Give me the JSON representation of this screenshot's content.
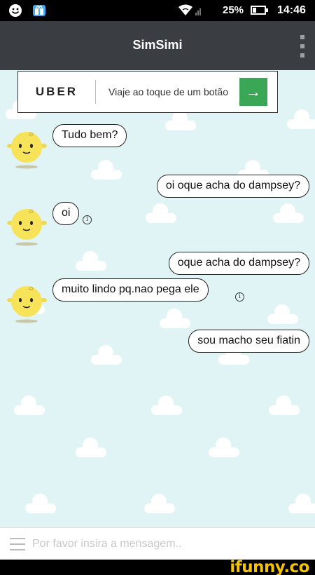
{
  "status_bar": {
    "battery": "25%",
    "time": "14:46",
    "left_icons": [
      "smiley-icon",
      "gift-icon"
    ]
  },
  "app_bar": {
    "title": "SimSimi",
    "menu_icon": "overflow-menu-icon"
  },
  "ad": {
    "brand": "UBER",
    "text": "Viaje ao toque de um botão",
    "cta_icon": "arrow-right-icon"
  },
  "messages": [
    {
      "from": "bot",
      "text": "Tudo bem?"
    },
    {
      "from": "user",
      "text": "oi oque acha do dampsey?"
    },
    {
      "from": "bot",
      "text": "oi"
    },
    {
      "from": "user",
      "text": "oque acha do dampsey?"
    },
    {
      "from": "bot",
      "text": "muito lindo pq.nao pega ele"
    },
    {
      "from": "user",
      "text": "sou macho seu fiatin"
    }
  ],
  "input": {
    "placeholder": "Por favor insira a mensagem.."
  },
  "watermark": "ifunny.co",
  "colors": {
    "app_bar": "#3a3d42",
    "chat_bg": "#e1f4f5",
    "simsimi_yellow": "#f7e35a",
    "uber_cta": "#3aa757",
    "watermark": "#f5c400"
  }
}
